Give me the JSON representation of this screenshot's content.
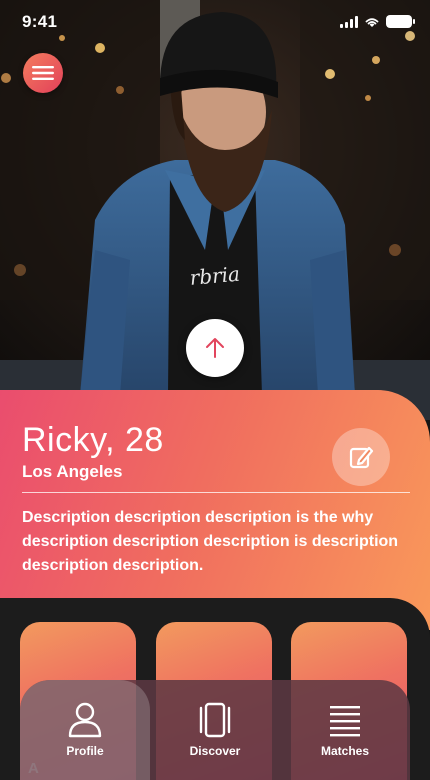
{
  "status_bar": {
    "time": "9:41"
  },
  "profile": {
    "name_age": "Ricky, 28",
    "location": "Los Angeles",
    "description": "Description description description is the why description description description is description description description."
  },
  "tiles": {
    "partial_label": "A"
  },
  "tabs": [
    {
      "label": "Profile",
      "icon": "person-icon",
      "active": true
    },
    {
      "label": "Discover",
      "icon": "cards-icon",
      "active": false
    },
    {
      "label": "Matches",
      "icon": "list-icon",
      "active": false
    }
  ],
  "colors": {
    "accent_start": "#ea4d6e",
    "accent_end": "#f9995a",
    "tabbar": "#5c3842",
    "background": "#1c1c1c"
  }
}
